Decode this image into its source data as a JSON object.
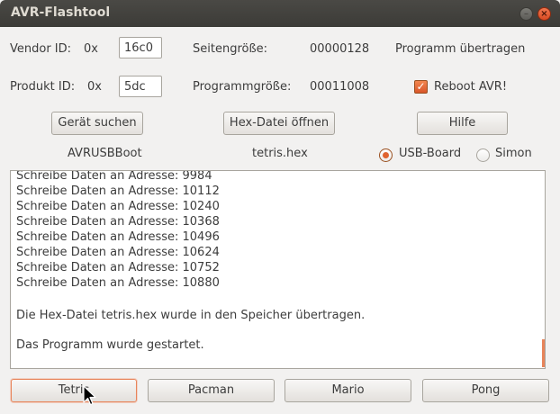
{
  "window": {
    "title": "AVR-Flashtool"
  },
  "vendor": {
    "label": "Vendor ID:",
    "prefix": "0x",
    "value": "16c0"
  },
  "product": {
    "label": "Produkt ID:",
    "prefix": "0x",
    "value": "5dc"
  },
  "page_size": {
    "label": "Seitengröße:",
    "value": "00000128"
  },
  "program_size": {
    "label": "Programmgröße:",
    "value": "00011008"
  },
  "transfer_status": "Programm übertragen",
  "reboot": {
    "label": "Reboot AVR!",
    "checked": true
  },
  "buttons": {
    "find_device": "Gerät suchen",
    "open_hex": "Hex-Datei öffnen",
    "help": "Hilfe"
  },
  "status": {
    "device": "AVRUSBBoot",
    "file": "tetris.hex"
  },
  "board": {
    "usb_label": "USB-Board",
    "simon_label": "Simon",
    "selected": "USB-Board"
  },
  "log": {
    "lines": [
      "Schreibe Daten an Adresse: 9984",
      "Schreibe Daten an Adresse: 10112",
      "Schreibe Daten an Adresse: 10240",
      "Schreibe Daten an Adresse: 10368",
      "Schreibe Daten an Adresse: 10496",
      "Schreibe Daten an Adresse: 10624",
      "Schreibe Daten an Adresse: 10752",
      "Schreibe Daten an Adresse: 10880"
    ],
    "written": "Die Hex-Datei tetris.hex wurde in den Speicher übertragen.",
    "started": "Das Programm wurde gestartet."
  },
  "games": [
    "Tetris",
    "Pacman",
    "Mario",
    "Pong"
  ],
  "colors": {
    "accent": "#e0632f",
    "titlebar": "#3c3b37",
    "window_bg": "#f2f1f0"
  }
}
